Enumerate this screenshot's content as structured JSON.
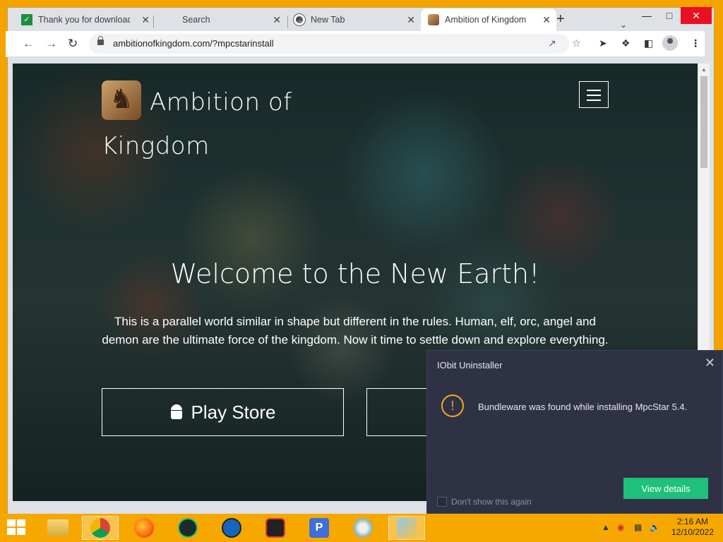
{
  "browser": {
    "tabs": [
      {
        "label": "Thank you for download",
        "active": false,
        "favicon": "tick-favicon-icon"
      },
      {
        "label": "Search",
        "active": false,
        "favicon": "none"
      },
      {
        "label": "New Tab",
        "active": false,
        "favicon": "chrome-icon"
      },
      {
        "label": "Ambition of Kingdom",
        "active": true,
        "favicon": "kingdom-favicon-icon"
      }
    ],
    "url": "ambitionofkingdom.com/?mpcstarinstall"
  },
  "page": {
    "brand": "Ambition of Kingdom",
    "hero_title": "Welcome to the New Earth!",
    "hero_text": "This is a parallel world similar in shape but different in the rules. Human, elf, orc, angel and demon are the ultimate force of the kingdom. Now it time to settle down and explore everything.",
    "play_store_label": "Play Store"
  },
  "popup": {
    "title": "IObit Uninstaller",
    "message": "Bundleware was found while installing MpcStar 5.4.",
    "view_details_label": "View details",
    "dont_show_label": "Don't show this again"
  },
  "taskbar": {
    "time": "2:16 AM",
    "date": "12/10/2022"
  },
  "colors": {
    "taskbar": "#f6a800",
    "popup_bg": "#2e3244",
    "accent_green": "#1ec07a",
    "warning": "#f5a623"
  }
}
